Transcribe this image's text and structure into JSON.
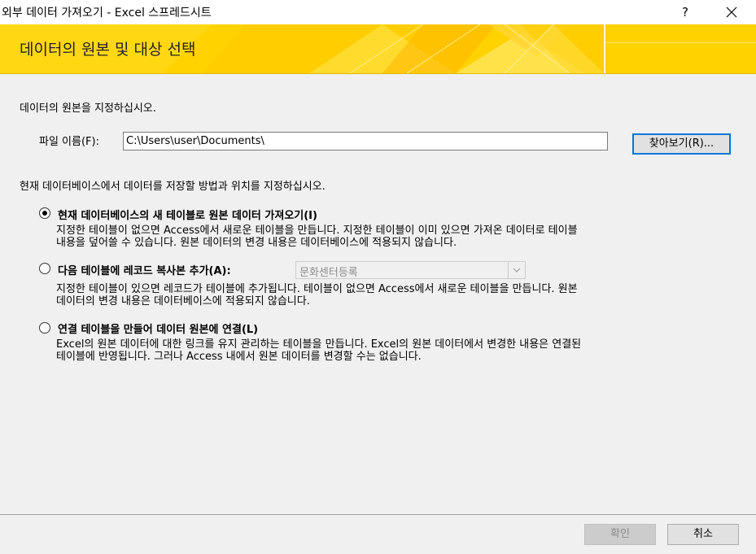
{
  "window": {
    "title": "외부 데이터 가져오기 - Excel 스프레드시트",
    "help_label": "?"
  },
  "banner": {
    "title": "데이터의 원본 및 대상 선택",
    "color": "#ffd200"
  },
  "source": {
    "prompt": "데이터의 원본을 지정하십시오.",
    "file_label": "파일 이름(F):",
    "file_value": "C:\\Users\\user\\Documents\\",
    "browse_label": "찾아보기(R)..."
  },
  "destination": {
    "prompt": "현재 데이터베이스에서 데이터를 저장할 방법과 위치를 지정하십시오.",
    "options": [
      {
        "label": "현재 데이터베이스의 새 테이블로 원본 데이터 가져오기(I)",
        "selected": true,
        "desc_line1": "지정한 테이블이 없으면 Access에서 새로운 테이블을 만듭니다. 지정한 테이블이 이미 있으면 가져온 데이터로 테이블",
        "desc_line2": "내용을 덮어쓸 수 있습니다. 원본 데이터의 변경 내용은 데이터베이스에 적용되지 않습니다."
      },
      {
        "label": "다음 테이블에 레코드 복사본 추가(A):",
        "selected": false,
        "combo_value": "문화센터등록",
        "desc_line1": "지정한 테이블이 있으면 레코드가 테이블에 추가됩니다. 테이블이 없으면 Access에서 새로운 테이블을 만듭니다. 원본",
        "desc_line2": "데이터의 변경 내용은 데이터베이스에 적용되지 않습니다."
      },
      {
        "label": "연결 테이블을 만들어 데이터 원본에 연결(L)",
        "selected": false,
        "desc_line1": "Excel의 원본 데이터에 대한 링크를 유지 관리하는 테이블을 만듭니다. Excel의 원본 데이터에서 변경한 내용은 연결된",
        "desc_line2": "테이블에 반영됩니다. 그러나 Access 내에서 원본 데이터를 변경할 수는 없습니다."
      }
    ]
  },
  "footer": {
    "ok_label": "확인",
    "cancel_label": "취소"
  }
}
